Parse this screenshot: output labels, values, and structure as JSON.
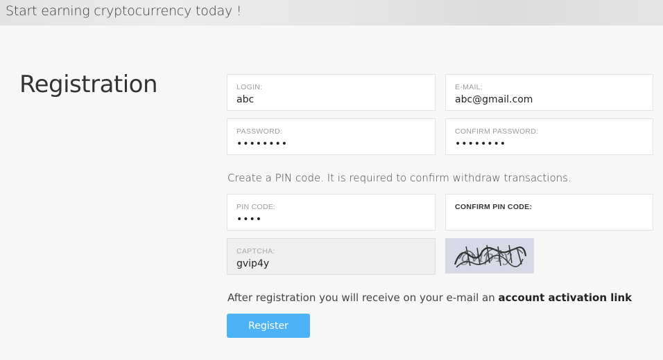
{
  "banner": {
    "text": "Start earning cryptocurrency today !"
  },
  "page_title": "Registration",
  "fields": {
    "login": {
      "label": "LOGIN:",
      "value": "abc"
    },
    "email": {
      "label": "E-MAIL:",
      "value": "abc@gmail.com"
    },
    "password": {
      "label": "PASSWORD:",
      "value": "abcdefgh"
    },
    "confirm_password": {
      "label": "CONFIRM PASSWORD:",
      "value": "abcdefgh"
    },
    "pin": {
      "label": "PIN CODE:",
      "value": "1234"
    },
    "confirm_pin": {
      "label": "CONFIRM PIN CODE:",
      "value": ""
    },
    "captcha": {
      "label": "CAPTCHA:",
      "value": "gvip4y"
    }
  },
  "pin_hint": "Create a PIN code. It is required to confirm withdraw transactions.",
  "activation_note": {
    "prefix": "After registration you will receive on your e-mail an ",
    "bold": "account activation link"
  },
  "register_button": "Register",
  "captcha_image": {
    "text": "gvip4y"
  }
}
